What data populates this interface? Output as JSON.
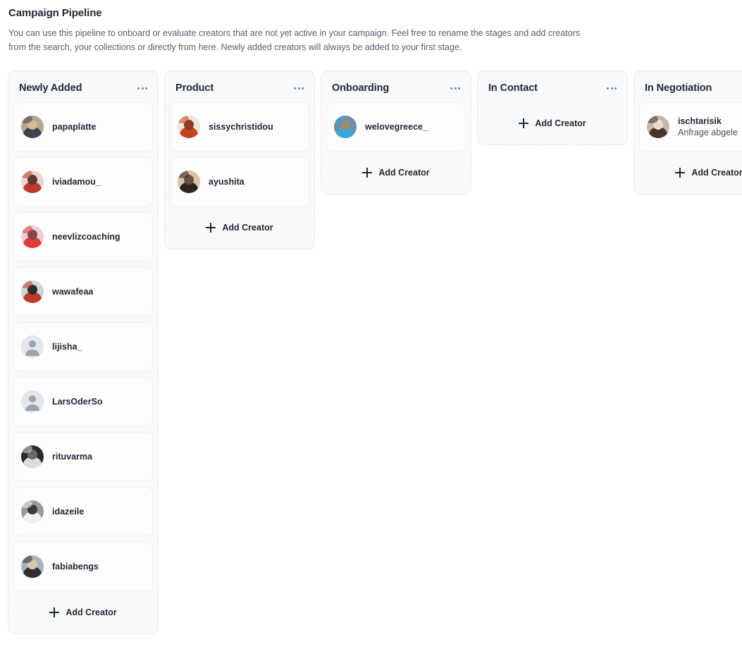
{
  "header": {
    "title": "Campaign Pipeline",
    "description": "You can use this pipeline to onboard or evaluate creators that are not yet active in your campaign. Feel free to rename the stages and add creators from the search, your collections or directly from here. Newly added creators will always be added to your first stage."
  },
  "labels": {
    "add_creator": "Add Creator",
    "kebab_menu": "…"
  },
  "colors": {
    "column_background": "#f8f9fb",
    "column_border": "#dfe3e8",
    "card_background": "#fdfdfe",
    "text_primary": "#1f2733",
    "text_secondary": "#57606a"
  },
  "columns": [
    {
      "title": "Newly Added",
      "has_menu": true,
      "add_creator_label": "Add Creator",
      "cards": [
        {
          "name": "papaplatte",
          "subtitle": "",
          "avatar": "photo",
          "avatar_colors": [
            "#b9a48e",
            "#3d4350",
            "#d8b79a"
          ]
        },
        {
          "name": "iviadamou_",
          "subtitle": "",
          "avatar": "photo",
          "avatar_colors": [
            "#e8d7cd",
            "#c0392b",
            "#5b3b2e"
          ]
        },
        {
          "name": "neevlizcoaching",
          "subtitle": "",
          "avatar": "photo",
          "avatar_colors": [
            "#f0cdd4",
            "#e23b3b",
            "#7d4a43"
          ]
        },
        {
          "name": "wawafeaa",
          "subtitle": "",
          "avatar": "photo",
          "avatar_colors": [
            "#cdd5dd",
            "#c0392b",
            "#2b2b2b"
          ]
        },
        {
          "name": "lijisha_",
          "subtitle": "",
          "avatar": "placeholder",
          "avatar_colors": [
            "#e3e6ea",
            "#9aa4b0",
            "#9aa4b0"
          ]
        },
        {
          "name": "LarsOderSo",
          "subtitle": "",
          "avatar": "placeholder",
          "avatar_colors": [
            "#e3e6ea",
            "#9aa4b0",
            "#9aa4b0"
          ]
        },
        {
          "name": "rituvarma",
          "subtitle": "",
          "avatar": "photo",
          "avatar_colors": [
            "#2a2a2a",
            "#dddddd",
            "#6a6a6a"
          ]
        },
        {
          "name": "idazeile",
          "subtitle": "",
          "avatar": "photo",
          "avatar_colors": [
            "#9a9a9a",
            "#efefef",
            "#3a3a3a"
          ]
        },
        {
          "name": "fabiabengs",
          "subtitle": "",
          "avatar": "photo",
          "avatar_colors": [
            "#a9b3c0",
            "#2e2e34",
            "#d9c6ae"
          ]
        }
      ]
    },
    {
      "title": "Product",
      "has_menu": true,
      "add_creator_label": "Add Creator",
      "cards": [
        {
          "name": "sissychristidou",
          "subtitle": "",
          "avatar": "photo",
          "avatar_colors": [
            "#efe3dc",
            "#c0451f",
            "#8a3c1d"
          ]
        },
        {
          "name": "ayushita",
          "subtitle": "",
          "avatar": "photo",
          "avatar_colors": [
            "#d8c3ab",
            "#2b2320",
            "#6b4f3f"
          ]
        }
      ]
    },
    {
      "title": "Onboarding",
      "has_menu": true,
      "add_creator_label": "Add Creator",
      "cards": [
        {
          "name": "welovegreece_",
          "subtitle": "",
          "avatar": "photo",
          "avatar_colors": [
            "#6f8fae",
            "#3aa6d8",
            "#a08a6a"
          ]
        }
      ]
    },
    {
      "title": "In Contact",
      "has_menu": true,
      "add_creator_label": "Add Creator",
      "cards": []
    },
    {
      "title": "In Negotiation",
      "has_menu": false,
      "add_creator_label": "Add Creator",
      "cards": [
        {
          "name": "ischtarisik",
          "subtitle": "Anfrage abgele",
          "avatar": "photo",
          "avatar_colors": [
            "#c8b8a8",
            "#4a342a",
            "#e8e0d4"
          ]
        }
      ]
    }
  ]
}
